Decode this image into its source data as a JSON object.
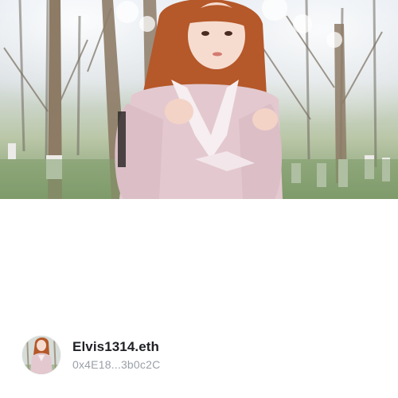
{
  "cover": {
    "image": "profile-cover-photo"
  },
  "profile": {
    "avatar": "profile-avatar-photo",
    "name": "Elvis1314.eth",
    "address": "0x4E18...3b0c2C"
  }
}
